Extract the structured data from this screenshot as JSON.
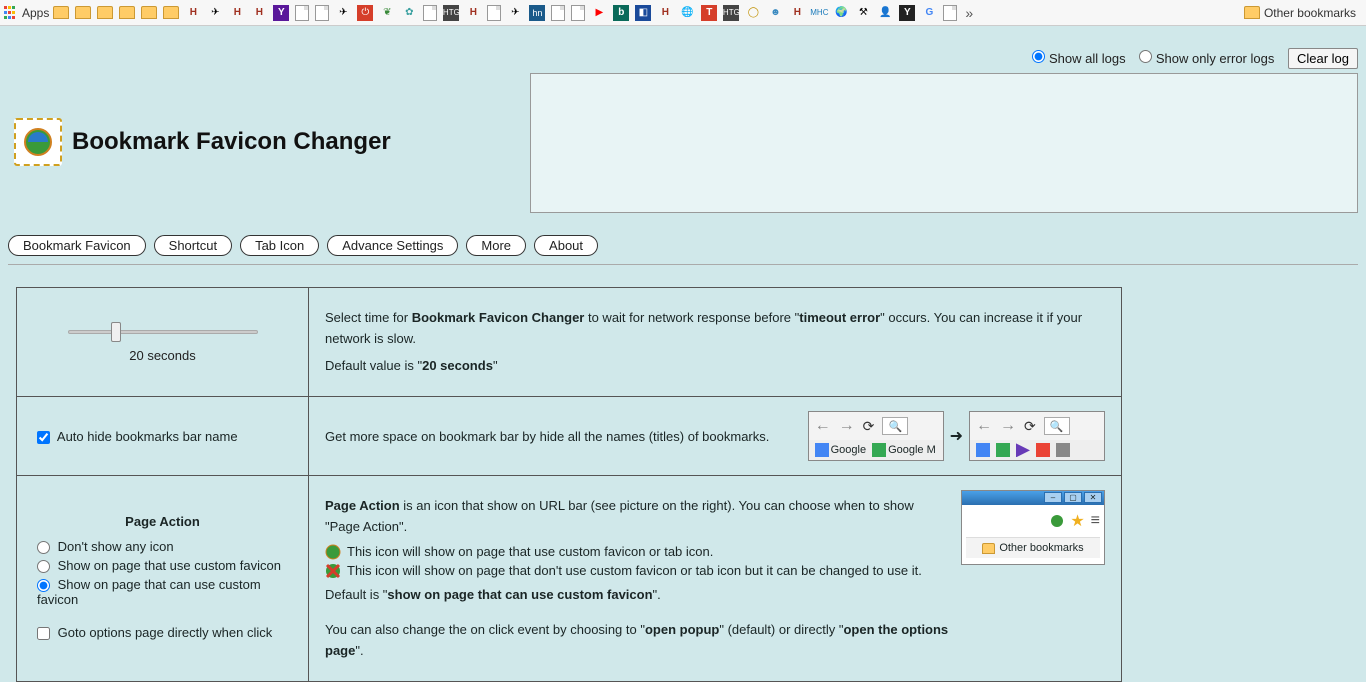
{
  "bookmarks_bar": {
    "apps_label": "Apps",
    "other_label": "Other bookmarks"
  },
  "header": {
    "title": "Bookmark Favicon Changer"
  },
  "log": {
    "show_all": "Show all logs",
    "show_errors": "Show only error logs",
    "clear": "Clear log"
  },
  "tabs": [
    "Bookmark Favicon",
    "Shortcut",
    "Tab Icon",
    "Advance Settings",
    "More",
    "About"
  ],
  "row1": {
    "slider_value": "20 seconds",
    "desc_a": "Select time for ",
    "desc_b": "Bookmark Favicon Changer",
    "desc_c": " to wait for network response before \"",
    "desc_d": "timeout error",
    "desc_e": "\" occurs. You can increase it if your network is slow.",
    "default_a": "Default value is \"",
    "default_b": "20 seconds",
    "default_c": "\""
  },
  "row2": {
    "checkbox": "Auto hide bookmarks bar name",
    "desc": "Get more space on bookmark bar by hide all the names (titles) of bookmarks.",
    "mb_google": "Google",
    "mb_google_m": "Google M"
  },
  "row3": {
    "heading": "Page Action",
    "opt1": "Don't show any icon",
    "opt2": "Show on page that use custom favicon",
    "opt3": "Show on page that can use custom favicon",
    "goto": "Goto options page directly when click",
    "d1a": "Page Action",
    "d1b": " is an icon that show on URL bar (see picture on the right). You can choose when to show \"Page Action\".",
    "d2": "This icon will show on page that use custom favicon or tab icon.",
    "d3": "This icon will show on page that don't use custom favicon or tab icon but it can be changed to use it.",
    "d4a": "Default is \"",
    "d4b": "show on page that can use custom favicon",
    "d4c": "\".",
    "d5a": "You can also change the on click event by choosing to \"",
    "d5b": "open popup",
    "d5c": "\" (default) or directly \"",
    "d5d": "open the options page",
    "d5e": "\".",
    "win_other": "Other bookmarks"
  }
}
